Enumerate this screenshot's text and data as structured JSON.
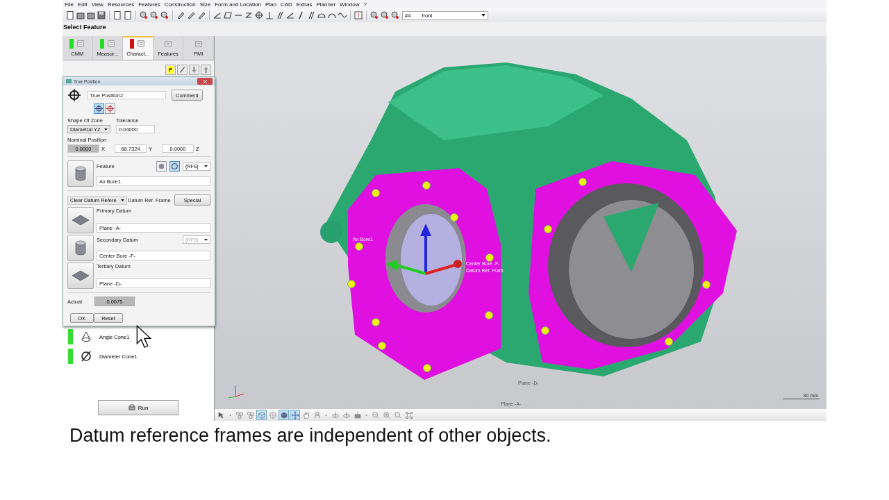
{
  "menu": [
    "File",
    "Edit",
    "View",
    "Resources",
    "Features",
    "Construction",
    "Size",
    "Form and Location",
    "Plan",
    "CAD",
    "Extras",
    "Planner",
    "Window",
    "?"
  ],
  "toolbar": {
    "number": "#4",
    "view": "front"
  },
  "mode_title": "Select Feature",
  "tabs": [
    {
      "label": "CMM",
      "color": "#22dd22",
      "selected": false
    },
    {
      "label": "Measur...",
      "color": "#22dd22",
      "selected": false
    },
    {
      "label": "Charact...",
      "color": "#cc1111",
      "selected": true
    },
    {
      "label": "Features",
      "selected": false
    },
    {
      "label": "PMI",
      "selected": false
    }
  ],
  "mini_toolbar": {
    "p_badge": "P"
  },
  "dialog": {
    "title": "True Position",
    "name": "True Position2",
    "comment_button": "Comment",
    "zone_buttons": [
      {
        "selected": true
      },
      {
        "selected": false
      }
    ],
    "shape_label": "Shape Of Zone",
    "shape_value": "Diametral YZ",
    "tolerance_label": "Tolerance",
    "tolerance_value": "0.04000",
    "nominal_label": "Nominal Position",
    "nominal": [
      {
        "value": "0.0000",
        "axis": "X",
        "disabled": true
      },
      {
        "value": "68.7324",
        "axis": "Y",
        "disabled": false
      },
      {
        "value": "0.0000",
        "axis": "Z",
        "disabled": false
      }
    ],
    "feature": {
      "label": "Feature",
      "value": "Ax Bore1",
      "modifier": "(RFS)",
      "modifier_buttons": [
        {
          "selected": false
        },
        {
          "selected": true
        }
      ]
    },
    "datum_dropdown": "Clear Datum Refere",
    "datum_label": "Datum Ref. Frame",
    "special_button": "Special",
    "datums": [
      {
        "kind": "plane",
        "label": "Primary Datum",
        "value": "Plane -A-"
      },
      {
        "kind": "cylinder",
        "label": "Secondary Datum",
        "value": "Center Bore -F-",
        "modifier": "(RFS)",
        "modifier_disabled": true
      },
      {
        "kind": "plane",
        "label": "Tertiary Datum",
        "value": "Plane -D-"
      }
    ],
    "actual_label": "Actual",
    "actual_value": "0.0075",
    "ok_button": "OK",
    "reset_button": "Reset"
  },
  "characteristics": [
    {
      "kind": "angle",
      "label": "Angle Cone1",
      "color": "#33dd33"
    },
    {
      "kind": "diameter",
      "label": "Diameter Cone1",
      "color": "#33dd33"
    }
  ],
  "run_button": "Run",
  "viewport": {
    "labels": [
      "Ax Bore1",
      "Center Bore -F-",
      "Datum Ref. Fram",
      "Plane -D-",
      "Plane -A-"
    ],
    "scale": "30 mm"
  },
  "view_toolbar": [
    {
      "kind": "select",
      "selected": false
    },
    {
      "kind": "dropdown",
      "selected": false
    },
    {
      "kind": "nodes",
      "selected": false
    },
    {
      "kind": "nodes",
      "selected": false
    },
    {
      "kind": "wire-cube",
      "selected": true
    },
    {
      "kind": "sphere",
      "selected": false
    },
    {
      "kind": "solid-cube",
      "selected": true
    },
    {
      "kind": "move",
      "selected": true
    },
    {
      "kind": "hand",
      "selected": false
    },
    {
      "kind": "person",
      "selected": false
    },
    {
      "kind": "dropdown",
      "selected": false
    },
    {
      "kind": "rotate",
      "selected": false
    },
    {
      "kind": "rotate",
      "selected": false
    },
    {
      "kind": "camera",
      "selected": false
    },
    {
      "kind": "dropdown",
      "selected": false
    },
    {
      "kind": "zoom-out",
      "selected": false
    },
    {
      "kind": "zoom-in",
      "selected": false
    },
    {
      "kind": "zoom",
      "selected": false
    },
    {
      "kind": "fit",
      "selected": false
    }
  ],
  "caption": "Datum reference frames are independent of other objects."
}
